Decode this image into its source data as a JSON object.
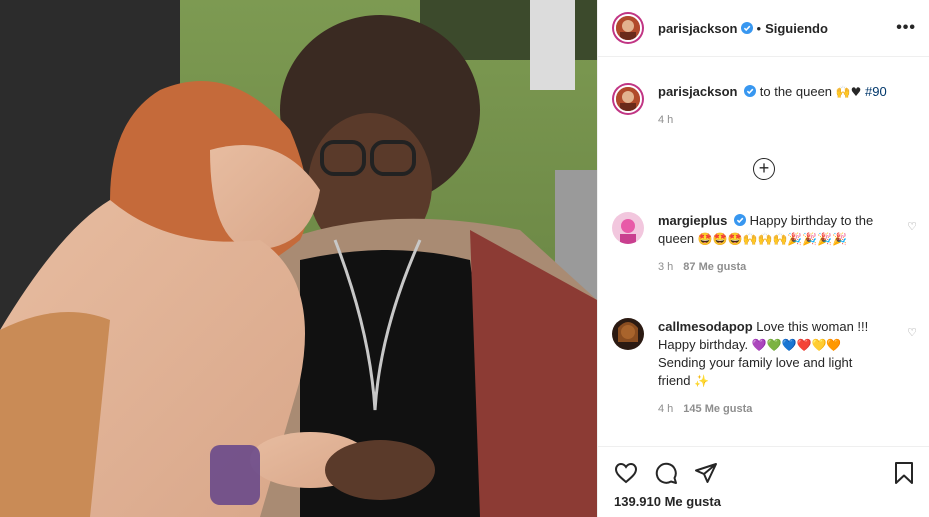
{
  "post": {
    "username": "parisjackson",
    "follow_label": "Siguiendo",
    "more_label": "•••",
    "caption_text": "to the queen",
    "caption_emoji": "🙌♥",
    "caption_hashtag": "#90",
    "caption_time": "4 h",
    "load_more_label": "+",
    "likes_label": "139.910 Me gusta"
  },
  "comments": [
    {
      "username": "margieplus",
      "verified": true,
      "text": "Happy birthday to the queen",
      "emoji": "🤩🤩🤩🙌🙌🙌🎉🎉🎉🎉",
      "time": "3 h",
      "likes": "87 Me gusta"
    },
    {
      "username": "callmesodapop",
      "verified": false,
      "text": "Love this woman !!! Happy birthday.",
      "emoji": "💜💚💙❤️💛🧡",
      "text2": "Sending your family love and light friend",
      "emoji2": "✨",
      "time": "4 h",
      "likes": "145 Me gusta"
    }
  ],
  "colors": {
    "verified": "#3897f0",
    "text": "#262626",
    "muted": "#8e8e8e",
    "border": "#efefef",
    "hashtag": "#00376b"
  }
}
